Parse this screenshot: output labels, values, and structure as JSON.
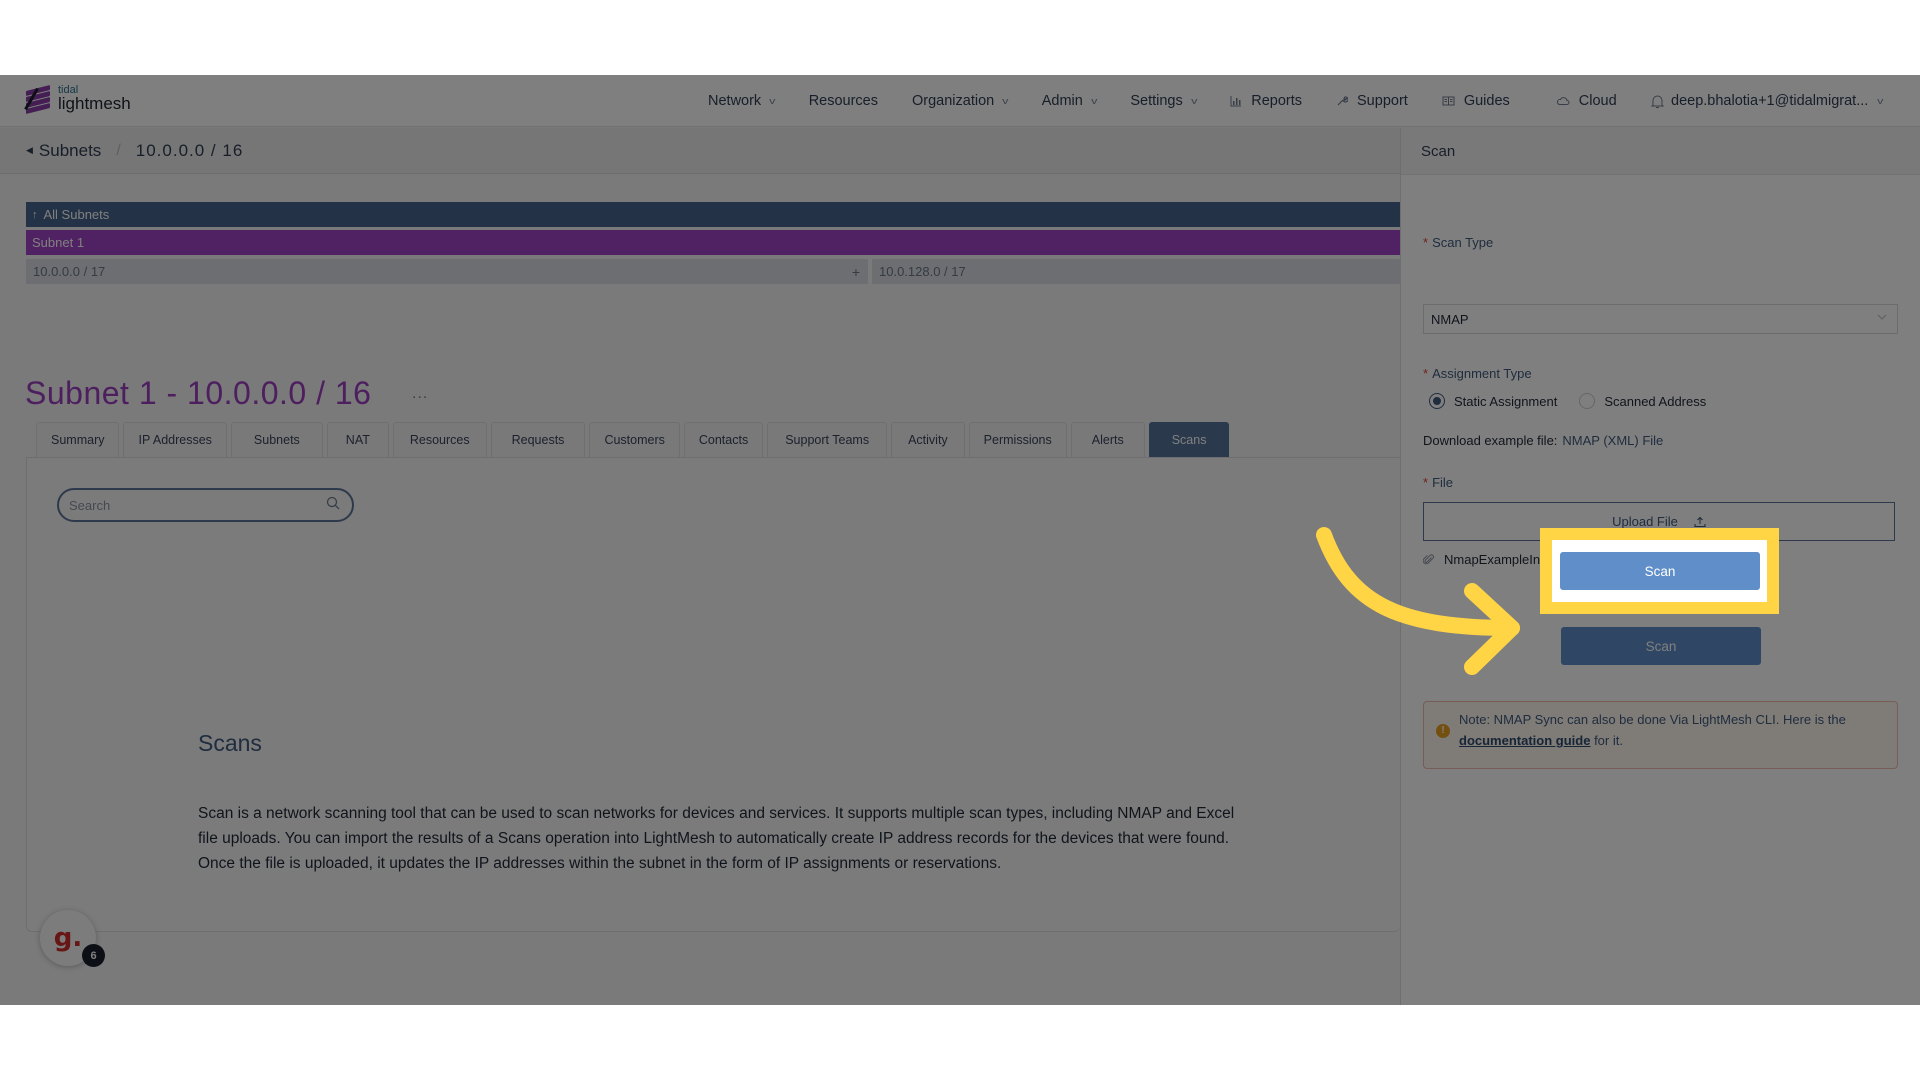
{
  "app": {
    "logo_top": "tidal",
    "logo_bottom": "lightmesh"
  },
  "nav": {
    "items": [
      {
        "label": "Network",
        "has_dropdown": true
      },
      {
        "label": "Resources",
        "has_dropdown": false
      },
      {
        "label": "Organization",
        "has_dropdown": true
      },
      {
        "label": "Admin",
        "has_dropdown": true
      },
      {
        "label": "Settings",
        "has_dropdown": true
      },
      {
        "label": "Reports",
        "icon": "bar-chart-icon"
      },
      {
        "label": "Support",
        "icon": "wrench-icon"
      },
      {
        "label": "Guides",
        "icon": "book-icon"
      },
      {
        "label": "Cloud",
        "icon": "cloud-icon"
      }
    ],
    "bell_icon": "bell-icon",
    "user": "deep.bhalotia+1@tidalmigrat..."
  },
  "breadcrumb": {
    "back_icon": "caret-left-icon",
    "parent": "Subnets",
    "separator": "/",
    "current": "10.0.0.0 / 16"
  },
  "subnet_tree": {
    "all_subnets": "All Subnets",
    "up_icon": "arrow-up-icon",
    "current": "Subnet 1",
    "children": [
      {
        "label": "10.0.0.0 / 17",
        "add": "+"
      },
      {
        "label": "10.0.128.0 / 17"
      }
    ]
  },
  "page": {
    "title": "Subnet 1 - 10.0.0.0 / 16",
    "more": "...",
    "tabs": [
      {
        "label": "Summary"
      },
      {
        "label": "IP Addresses"
      },
      {
        "label": "Subnets"
      },
      {
        "label": "NAT"
      },
      {
        "label": "Resources"
      },
      {
        "label": "Requests"
      },
      {
        "label": "Customers"
      },
      {
        "label": "Contacts"
      },
      {
        "label": "Support Teams"
      },
      {
        "label": "Activity"
      },
      {
        "label": "Permissions"
      },
      {
        "label": "Alerts"
      },
      {
        "label": "Scans",
        "active": true
      }
    ],
    "search": {
      "placeholder": "Search",
      "value": ""
    },
    "scans_heading": "Scans",
    "scans_description": "Scan is a network scanning tool that can be used to scan networks for devices and services. It supports multiple scan types, including NMAP and Excel file uploads. You can import the results of a Scans operation into LightMesh to automatically create IP address records for the devices that were found. Once the file is uploaded, it updates the IP addresses within the subnet in the form of IP assignments or reservations."
  },
  "avatar": {
    "letter": "g.",
    "badge_count": "6"
  },
  "scan_panel": {
    "title": "Scan",
    "required_mark": "*",
    "scan_type_label": "Scan Type",
    "scan_type_value": "NMAP",
    "assignment_type_label": "Assignment Type",
    "assignment_options": [
      {
        "label": "Static Assignment",
        "selected": true
      },
      {
        "label": "Scanned Address",
        "selected": false
      }
    ],
    "download_label": "Download example file:",
    "download_link": "NMAP (XML) File",
    "file_label": "File",
    "upload_label": "Upload File",
    "uploaded_file": "NmapExampleInsideSubnet (6).xml",
    "scan_button": "Scan",
    "note_text": "Note: NMAP Sync can also be done Via LightMesh CLI. Here is the ",
    "note_link": "documentation guide",
    "note_suffix": " for it."
  },
  "colors": {
    "accent_blue": "#5f8ec9",
    "subnet_purple": "#a244c6",
    "highlight_yellow": "#ffd445",
    "nav_dark": "#46648c"
  }
}
